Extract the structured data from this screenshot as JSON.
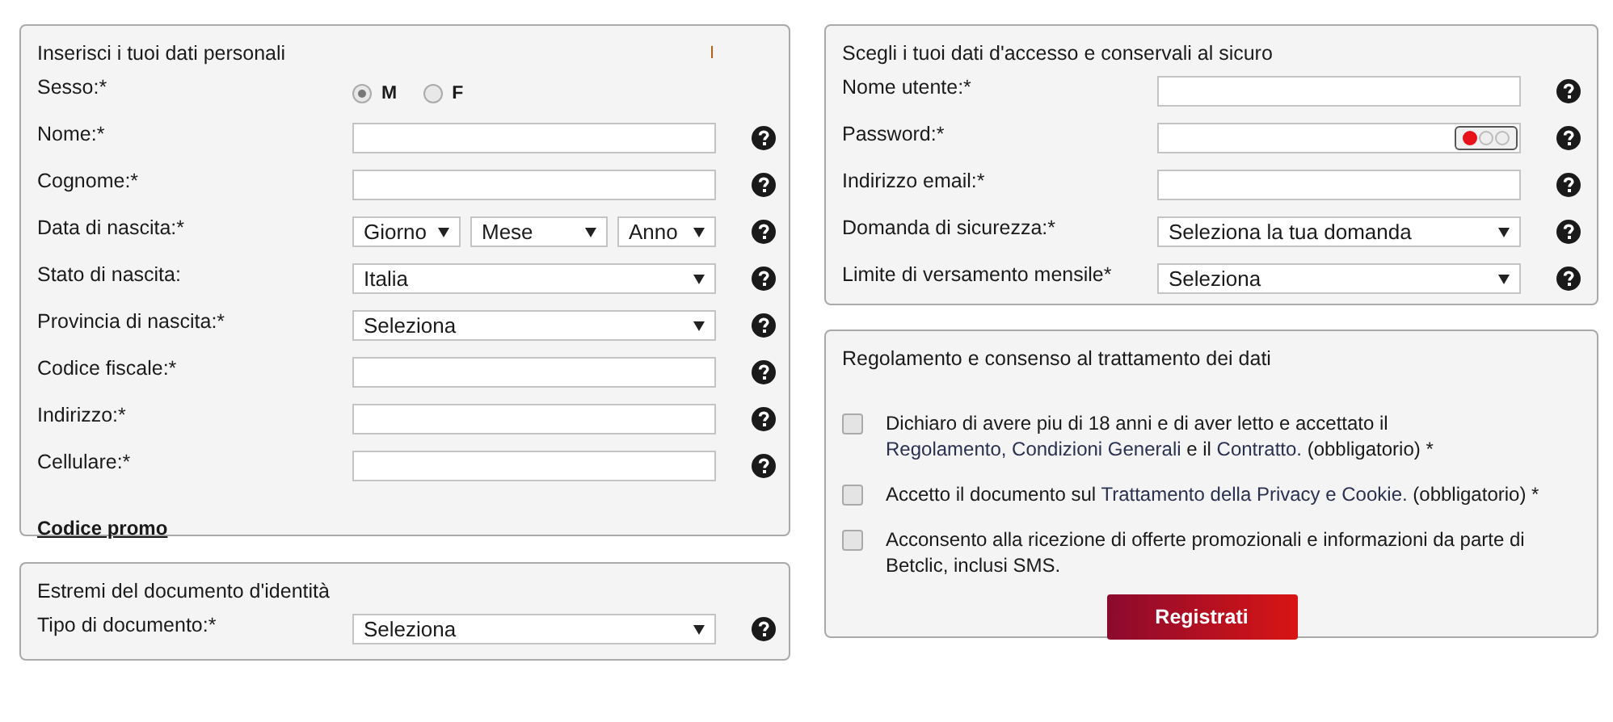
{
  "personal": {
    "title": "Inserisci i tuoi dati personali",
    "marker": "I",
    "rows": [
      {
        "label": "Sesso:*",
        "kind": "radio",
        "help": false,
        "options": [
          {
            "label": "M",
            "selected": true
          },
          {
            "label": "F",
            "selected": false
          }
        ]
      },
      {
        "label": "Nome:*",
        "kind": "text",
        "help": true
      },
      {
        "label": "Cognome:*",
        "kind": "text",
        "help": true
      },
      {
        "label": "Data di nascita:*",
        "kind": "date",
        "help": true,
        "selects": [
          {
            "value": "Giorno"
          },
          {
            "value": "Mese"
          },
          {
            "value": "Anno"
          }
        ]
      },
      {
        "label": "Stato di nascita:",
        "kind": "select",
        "help": true,
        "value": "Italia"
      },
      {
        "label": "Provincia di nascita:*",
        "kind": "select",
        "help": true,
        "value": "Seleziona"
      },
      {
        "label": "Codice fiscale:*",
        "kind": "text",
        "help": true
      },
      {
        "label": "Indirizzo:*",
        "kind": "text",
        "help": true
      },
      {
        "label": "Cellulare:*",
        "kind": "text",
        "help": true
      }
    ],
    "link": "Codice promo"
  },
  "document": {
    "title": "Estremi del documento d'identità",
    "rows": [
      {
        "label": "Tipo di documento:*",
        "kind": "select",
        "help": true,
        "value": "Seleziona"
      }
    ]
  },
  "access": {
    "title": "Scegli i tuoi dati d'accesso e conservali al sicuro",
    "rows": [
      {
        "label": "Nome utente:*",
        "kind": "text",
        "help": true
      },
      {
        "label": "Password:*",
        "kind": "password",
        "help": true,
        "level": 0.33
      },
      {
        "label": "Indirizzo email:*",
        "kind": "text",
        "help": true
      },
      {
        "label": "Domanda di sicurezza:*",
        "kind": "select",
        "help": true,
        "value": "Seleziona la tua domanda"
      },
      {
        "label": "Limite di versamento mensile*",
        "kind": "select",
        "help": true,
        "value": "Seleziona"
      }
    ]
  },
  "consent": {
    "title": "Regolamento e consenso al trattamento dei dati",
    "items": [
      {
        "checked": false,
        "parts": [
          {
            "kind": "plain",
            "text": "Dichiaro di avere piu di 18 anni e di aver letto e accettato il "
          },
          {
            "kind": "link",
            "text": "Regolamento, Condizioni Generali"
          },
          {
            "kind": "plain",
            "text": " e il "
          },
          {
            "kind": "link",
            "text": "Contratto."
          },
          {
            "kind": "plain",
            "text": " (obbligatorio) *"
          }
        ]
      },
      {
        "checked": false,
        "parts": [
          {
            "kind": "plain",
            "text": "Accetto il documento sul "
          },
          {
            "kind": "link",
            "text": "Trattamento della Privacy e Cookie."
          },
          {
            "kind": "plain",
            "text": " (obbligatorio) *"
          }
        ]
      },
      {
        "checked": false,
        "parts": [
          {
            "kind": "plain",
            "text": "Acconsento alla ricezione di offerte promozionali e informazioni da parte di Betclic, inclusi SMS."
          }
        ]
      }
    ],
    "button": "Registrati"
  }
}
